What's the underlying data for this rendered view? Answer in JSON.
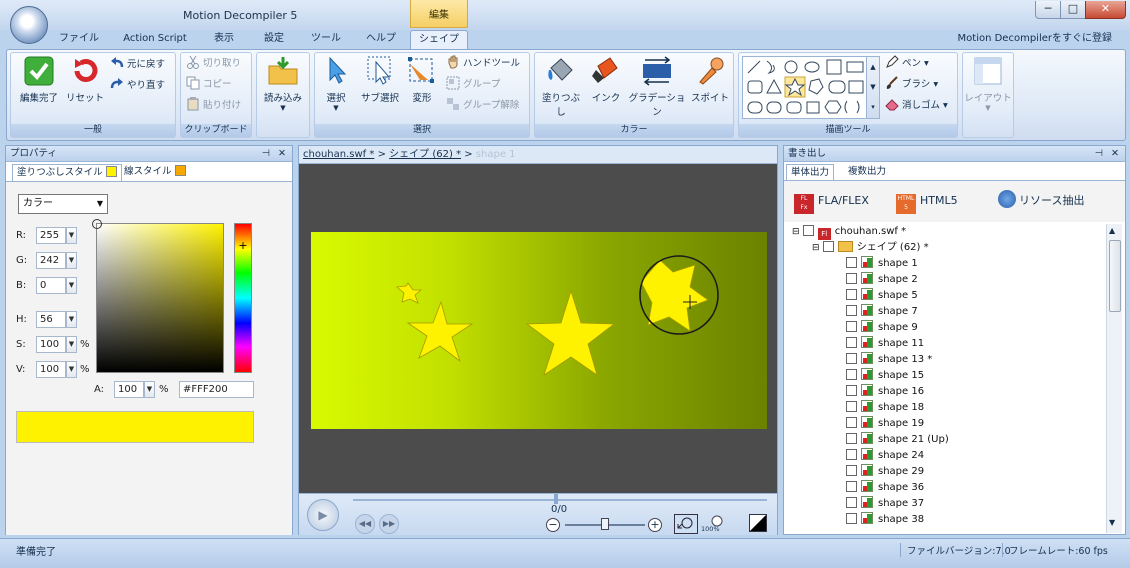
{
  "window": {
    "title": "Motion Decompiler 5",
    "context_tab_title": "編集",
    "min": "─",
    "max": "□",
    "close": "✕"
  },
  "tabs": [
    "ファイル",
    "Action Script",
    "表示",
    "設定",
    "ツール",
    "ヘルプ",
    "シェイプ"
  ],
  "promo": "Motion Decompilerをすぐに登録",
  "ribbon": {
    "general": {
      "label": "一般",
      "finish": "編集完了",
      "reset": "リセット",
      "undo": "元に戻す",
      "redo": "やり直す"
    },
    "clipboard": {
      "label": "クリップボード",
      "cut": "切り取り",
      "copy": "コピー",
      "paste": "貼り付け"
    },
    "load": {
      "label": "読み込み"
    },
    "select": {
      "label": "選択",
      "select": "選択",
      "subselect": "サブ選択",
      "transform": "変形",
      "hand": "ハンドツール",
      "group": "グループ",
      "ungroup": "グループ解除"
    },
    "color": {
      "label": "カラー",
      "fill": "塗りつぶし",
      "ink": "インク",
      "gradient": "グラデーション",
      "dropper": "スポイト"
    },
    "draw": {
      "label": "描画ツール",
      "pen": "ペン",
      "brush": "ブラシ",
      "eraser": "消しゴム"
    },
    "layout": {
      "label": "レイアウト"
    }
  },
  "properties": {
    "title": "プロパティ",
    "tab_fill": "塗りつぶしスタイル",
    "tab_line": "線スタイル",
    "mode": "カラー",
    "r_label": "R:",
    "r": "255",
    "g_label": "G:",
    "g": "242",
    "b_label": "B:",
    "b": "0",
    "h_label": "H:",
    "h": "56",
    "s_label": "S:",
    "s": "100",
    "v_label": "V:",
    "v": "100",
    "a_label": "A:",
    "a": "100",
    "pct": "%",
    "hex": "#FFF200",
    "swatch_color": "#FFF200"
  },
  "canvas": {
    "tab_file": "chouhan.swf *",
    "sep": ">",
    "tab_shape": "シェイプ (62) *",
    "tab_current": "shape 1",
    "frame": "0/0",
    "zoom_label": "100%"
  },
  "export": {
    "title": "書き出し",
    "tab_single": "単体出力",
    "tab_multi": "複数出力",
    "btn_fla": "FLA/FLEX",
    "btn_html": "HTML5",
    "btn_resource": "リソース抽出",
    "root": "chouhan.swf *",
    "folder": "シェイプ (62) *",
    "items": [
      "shape 1",
      "shape 2",
      "shape 5",
      "shape 7",
      "shape 9",
      "shape 11",
      "shape 13 *",
      "shape 15",
      "shape 16",
      "shape 18",
      "shape 19",
      "shape 21 (Up)",
      "shape 24",
      "shape 29",
      "shape 36",
      "shape 37",
      "shape 38"
    ]
  },
  "status": {
    "ready": "準備完了",
    "file_version": "ファイルバージョン:7.0",
    "framerate": "フレームレート:60 fps"
  },
  "colors": {
    "accent": "#FFF200",
    "ribbon_bg": "#DDE8F6",
    "stage_dark": "#4C4C4C"
  }
}
